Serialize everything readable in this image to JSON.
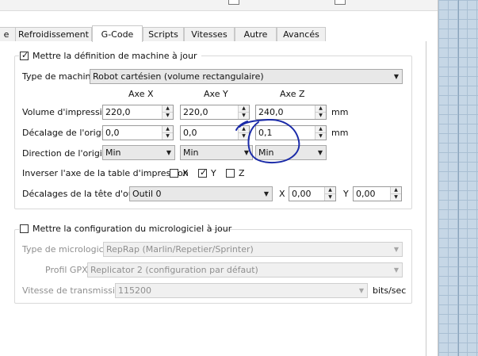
{
  "tabs": [
    {
      "label": "e"
    },
    {
      "label": "Refroidissement"
    },
    {
      "label": "G-Code"
    },
    {
      "label": "Scripts"
    },
    {
      "label": "Vitesses"
    },
    {
      "label": "Autre"
    },
    {
      "label": "Avancés"
    }
  ],
  "active_tab": "G-Code",
  "machine": {
    "checkbox_label": "Mettre la définition de machine à jour",
    "checked": true,
    "type_label": "Type de machine",
    "type_value": "Robot cartésien (volume rectangulaire)",
    "axis_headers": [
      "Axe X",
      "Axe Y",
      "Axe Z"
    ],
    "build_volume": {
      "label": "Volume d'impression",
      "x": "220,0",
      "y": "220,0",
      "z": "240,0",
      "unit": "mm"
    },
    "origin_offset": {
      "label": "Décalage de l'origine",
      "x": "0,0",
      "y": "0,0",
      "z": "0,1",
      "unit": "mm"
    },
    "origin_direction": {
      "label": "Direction de l'origine",
      "x": "Min",
      "y": "Min",
      "z": "Min"
    },
    "invert_bed": {
      "label": "Inverser l'axe de la table d'impression",
      "x_label": "X",
      "y_label": "Y",
      "z_label": "Z",
      "x": false,
      "y": true,
      "z": false
    },
    "tool_offsets": {
      "label": "Décalages de la tête d'outil",
      "tool": "Outil 0",
      "x_label": "X",
      "x": "0,00",
      "y_label": "Y",
      "y": "0,00"
    }
  },
  "firmware": {
    "checkbox_label": "Mettre la configuration du micrologiciel à jour",
    "checked": false,
    "type_label": "Type de micrologiciel",
    "type_value": "RepRap (Marlin/Repetier/Sprinter)",
    "gpx_label": "Profil GPX",
    "gpx_value": "Replicator 2 (configuration par défaut)",
    "baud_label": "Vitesse de transmission",
    "baud_value": "115200",
    "baud_unit": "bits/sec"
  },
  "annotation_color": "#1a2aa8"
}
